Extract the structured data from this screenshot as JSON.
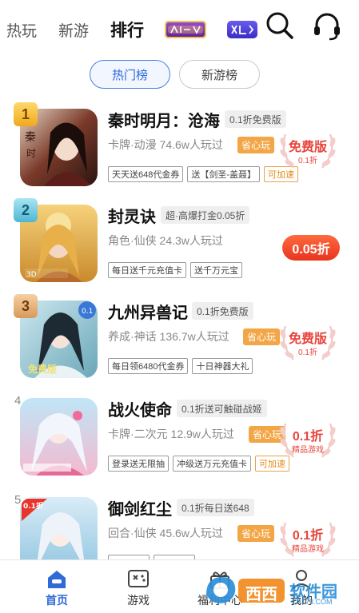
{
  "top_nav": {
    "tabs": [
      {
        "label": "热玩",
        "active": false
      },
      {
        "label": "新游",
        "active": false
      },
      {
        "label": "排行",
        "active": true
      }
    ],
    "badges": [
      {
        "icon": "brand-badge-icon",
        "color": "#7a2fb5"
      },
      {
        "icon": "game-badge-icon",
        "color": "#5b35d6"
      }
    ],
    "search_icon": "search-icon",
    "service_icon": "headset-icon"
  },
  "segments": [
    {
      "label": "热门榜",
      "active": true
    },
    {
      "label": "新游榜",
      "active": false
    }
  ],
  "colors": {
    "accent": "#2f6ad8",
    "discount": "#e8453c",
    "save": "#f2a646",
    "gold": "#f3b52a",
    "teal": "#5bc1d9",
    "bronze": "#e0a870"
  },
  "games": [
    {
      "rank": "1",
      "name": "秦时明月：沧海",
      "discount_tag": "0.1折免费版",
      "meta": "卡牌·动漫  74.6w人玩过",
      "save_tag": "省心玩",
      "chips": [
        "天天送648代金券",
        "送【剑圣-盖聂】",
        "可加速"
      ],
      "award_main": "免费版",
      "award_sub": "0.1折"
    },
    {
      "rank": "2",
      "name": "封灵诀",
      "discount_tag": "超·高爆打金0.05折",
      "meta": "角色·仙侠  24.3w人玩过",
      "chips": [
        "每日送千元充值卡",
        "送千万元宝"
      ],
      "pill": "0.05折"
    },
    {
      "rank": "3",
      "name": "九州异兽记",
      "discount_tag": "0.1折免费版",
      "meta": "养成·神话  136.7w人玩过",
      "save_tag": "省心玩",
      "chips": [
        "每日领6480代金券",
        "十日神器大礼"
      ],
      "award_main": "免费版",
      "award_sub": "0.1折"
    },
    {
      "rank": "4",
      "name": "战火使命",
      "discount_tag": "0.1折送可触碰战姬",
      "meta": "卡牌·二次元  12.9w人玩过",
      "save_tag": "省心玩",
      "chips": [
        "登录送无限抽",
        "冲级送万元充值卡",
        "可加速"
      ],
      "award_main": "0.1折",
      "award_sub": "精品游戏"
    },
    {
      "rank": "5",
      "name": "御剑红尘",
      "discount_tag": "0.1折每日送648",
      "meta": "回合·仙侠  45.6w人玩过",
      "save_tag": "省心玩",
      "award_main": "0.1折",
      "award_sub": "精品游戏"
    }
  ],
  "bottom_nav": [
    {
      "label": "首页",
      "icon": "home-icon",
      "active": true
    },
    {
      "label": "游戏",
      "icon": "gamepad-icon",
      "active": false
    },
    {
      "label": "福利中心",
      "icon": "gift-icon",
      "active": false
    },
    {
      "label": "我的",
      "icon": "user-icon",
      "active": false
    }
  ],
  "watermark": {
    "brand": "西西",
    "suffix": "软件园",
    "site": "CR173.COM"
  }
}
